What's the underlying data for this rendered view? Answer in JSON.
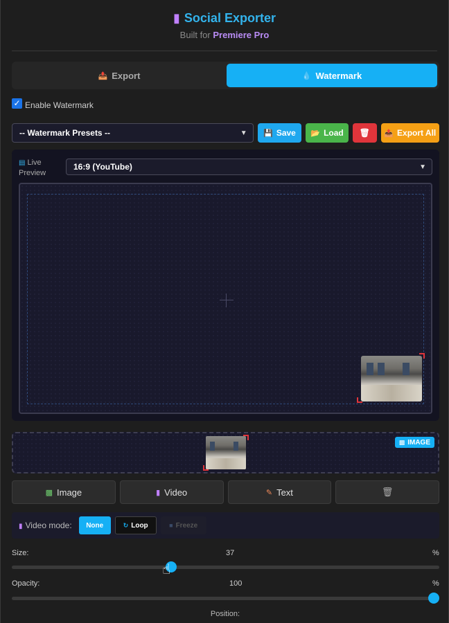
{
  "app": {
    "title": "Social Exporter",
    "subtitle_prefix": "Built for",
    "subtitle_brand": "Premiere Pro"
  },
  "tabs": [
    {
      "label": "Export",
      "icon": "export-icon",
      "active": false
    },
    {
      "label": "Watermark",
      "icon": "watermark-icon",
      "active": true
    }
  ],
  "enable_watermark": {
    "label": "Enable Watermark",
    "checked": true
  },
  "presets": {
    "selected": "-- Watermark Presets --",
    "save_label": "Save",
    "load_label": "Load",
    "export_all_label": "Export All"
  },
  "preview": {
    "label_line1": "Live",
    "label_line2": "Preview",
    "aspect_selected": "16:9 (YouTube)"
  },
  "dropzone": {
    "badge_label": "IMAGE"
  },
  "sources": {
    "image_label": "Image",
    "video_label": "Video",
    "text_label": "Text"
  },
  "video_mode": {
    "label": "Video mode:",
    "none_label": "None",
    "loop_label": "Loop",
    "freeze_label": "Freeze",
    "selected": "None"
  },
  "size": {
    "label": "Size:",
    "value": "37",
    "unit": "%",
    "fraction": 0.37
  },
  "opacity": {
    "label": "Opacity:",
    "value": "100",
    "unit": "%",
    "fraction": 1.0
  },
  "position": {
    "label": "Position:"
  },
  "colors": {
    "accent": "#16b0f5",
    "save": "#1fa8ef",
    "load": "#4ab54a",
    "delete": "#e0353b",
    "export_all": "#f5a015"
  }
}
